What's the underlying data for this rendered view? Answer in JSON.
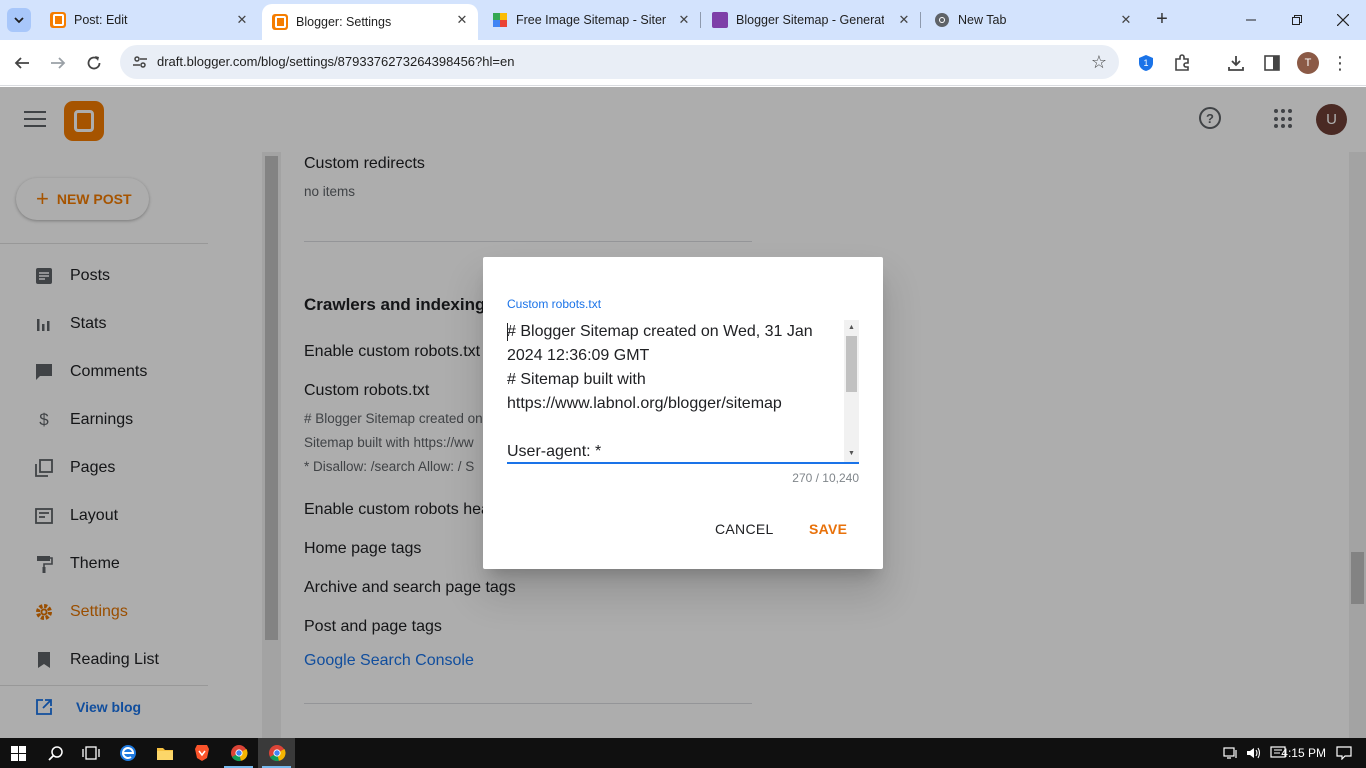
{
  "browser": {
    "tabs": [
      {
        "title": "Post: Edit",
        "favicon": "blogger-icon",
        "active": false
      },
      {
        "title": "Blogger: Settings",
        "favicon": "blogger-icon",
        "active": true
      },
      {
        "title": "Free Image Sitemap - Sitemap",
        "favicon": "puzzle-icon",
        "active": false
      },
      {
        "title": "Blogger Sitemap - Generate",
        "favicon": "labnol-icon",
        "active": false
      },
      {
        "title": "New Tab",
        "favicon": "chrome-icon",
        "active": false
      }
    ],
    "url": "draft.blogger.com/blog/settings/8793376273264398456?hl=en",
    "profile_initial": "T"
  },
  "app": {
    "avatar_initial": "U",
    "accent": "#f57d00"
  },
  "sidebar": {
    "new_post_label": "NEW POST",
    "items": [
      {
        "label": "Posts",
        "icon": "posts-icon"
      },
      {
        "label": "Stats",
        "icon": "stats-icon"
      },
      {
        "label": "Comments",
        "icon": "comments-icon"
      },
      {
        "label": "Earnings",
        "icon": "dollar-icon"
      },
      {
        "label": "Pages",
        "icon": "pages-icon"
      },
      {
        "label": "Layout",
        "icon": "layout-icon"
      },
      {
        "label": "Theme",
        "icon": "paint-roller-icon"
      },
      {
        "label": "Settings",
        "icon": "gear-icon",
        "active": true
      },
      {
        "label": "Reading List",
        "icon": "bookmark-icon"
      }
    ],
    "view_blog_label": "View blog"
  },
  "main": {
    "custom_redirects_title": "Custom redirects",
    "custom_redirects_sub": "no items",
    "crawlers_heading": "Crawlers and indexing",
    "enable_robots_title": "Enable custom robots.txt",
    "custom_robots_title": "Custom robots.txt",
    "custom_robots_preview_1": "# Blogger Sitemap created on",
    "custom_robots_preview_2": "Sitemap built with https://ww",
    "custom_robots_preview_3": "* Disallow: /search Allow: / S",
    "enable_robots_header_title": "Enable custom robots header tags",
    "home_page_tags": "Home page tags",
    "archive_search_tags": "Archive and search page tags",
    "post_page_tags": "Post and page tags",
    "search_console_link": "Google Search Console"
  },
  "dialog": {
    "field_label": "Custom robots.txt",
    "content": "# Blogger Sitemap created on Wed, 31 Jan 2024 12:36:09 GMT\n# Sitemap built with https://www.labnol.org/blogger/sitemap\n\nUser-agent: *",
    "char_count": "270 / 10,240",
    "cancel_label": "CANCEL",
    "save_label": "SAVE"
  },
  "taskbar": {
    "time": "4:15 PM"
  }
}
